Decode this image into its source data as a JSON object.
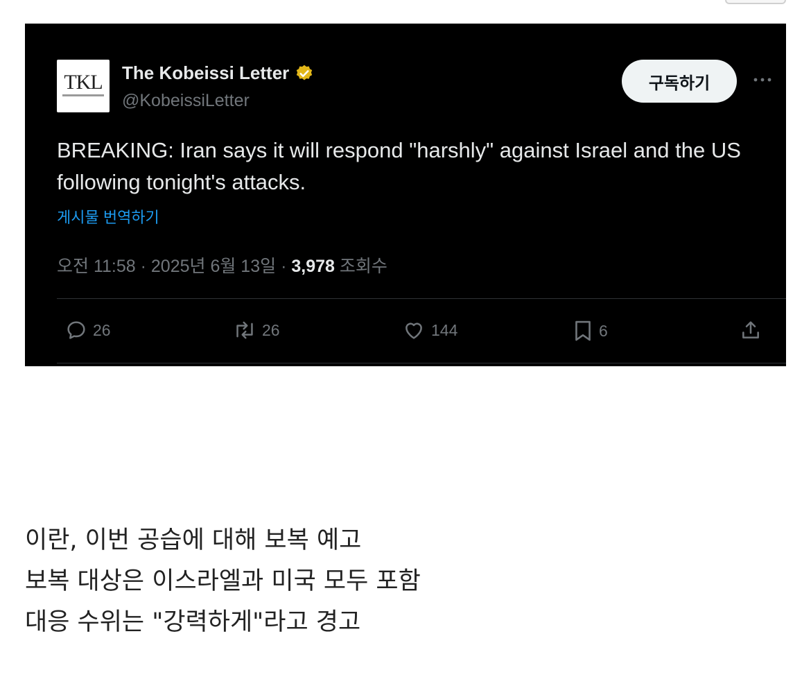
{
  "tweet": {
    "author": {
      "name": "The Kobeissi Letter",
      "handle": "@KobeissiLetter",
      "avatar_text": "TKL",
      "verified_color": "#e2b719"
    },
    "follow_label": "구독하기",
    "more_label": "···",
    "text": "BREAKING: Iran says it will respond \"harshly\" against Israel and the US following tonight's attacks.",
    "translate_label": "게시물 번역하기",
    "meta": {
      "time": "오전 11:58",
      "date": "2025년 6월 13일",
      "views_count": "3,978",
      "views_label": "조회수"
    },
    "actions": {
      "replies": "26",
      "reposts": "26",
      "likes": "144",
      "bookmarks": "6"
    }
  },
  "caption": {
    "line1": "이란, 이번 공습에 대해 보복 예고",
    "line2": "보복 대상은 이스라엘과 미국 모두 포함",
    "line3": "대응 수위는 \"강력하게\"라고 경고"
  },
  "colors": {
    "card_bg": "#000000",
    "text_primary": "#e7e9ea",
    "text_secondary": "#71767b",
    "link": "#1d9bf0"
  }
}
